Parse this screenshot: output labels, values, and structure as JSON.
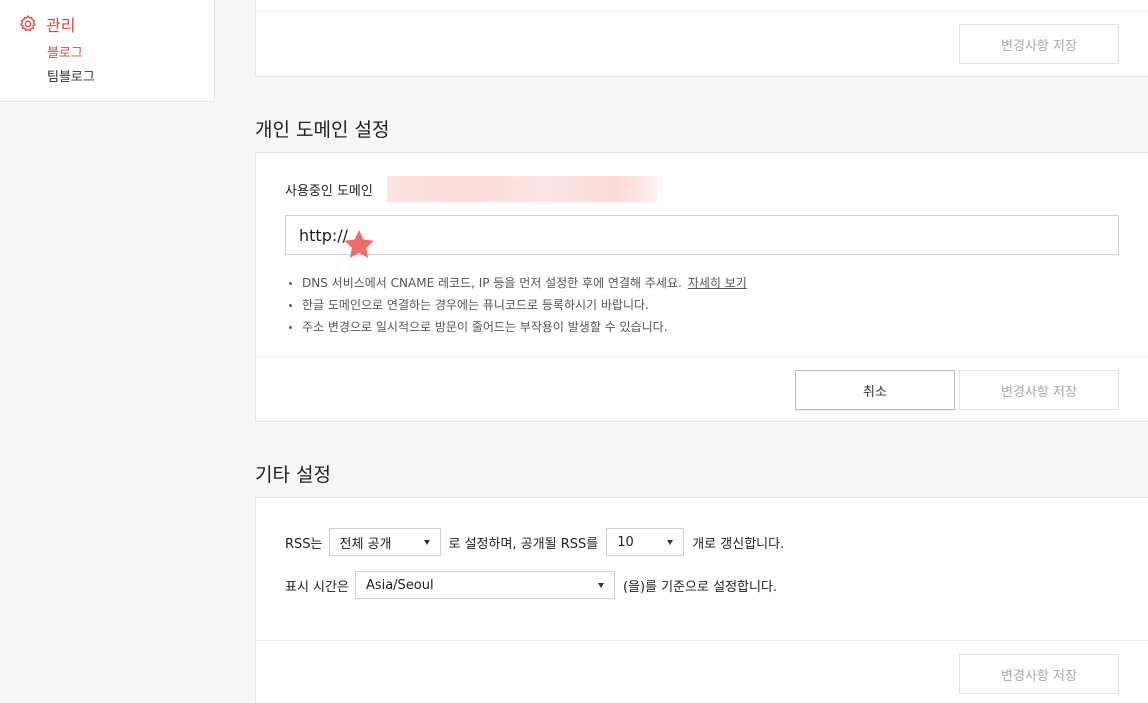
{
  "sidebar": {
    "heading": "관리",
    "items": [
      {
        "label": "블로그",
        "active": true
      },
      {
        "label": "팀블로그",
        "active": false
      }
    ]
  },
  "top_card": {
    "save_label": "변경사항 저장"
  },
  "domain_section": {
    "title": "개인 도메인 설정",
    "current_domain_label": "사용중인 도메인",
    "url_value": "http://",
    "notes": [
      "DNS 서비스에서 CNAME 레코드, IP 등을 먼저 설정한 후에 연결해 주세요.",
      "한글 도메인으로 연결하는 경우에는 퓨니코드로 등록하시기 바랍니다.",
      "주소 변경으로 일시적으로 방문이 줄어드는 부작용이 발생할 수 있습니다."
    ],
    "more_link": "자세히 보기",
    "cancel_label": "취소",
    "save_label": "변경사항 저장"
  },
  "other_section": {
    "title": "기타 설정",
    "rss_prefix": "RSS는",
    "rss_visibility": "전체 공개",
    "rss_middle": "로 설정하며, 공개될 RSS를",
    "rss_count": "10",
    "rss_suffix": "개로 갱신합니다.",
    "tz_prefix": "표시 시간은",
    "tz_value": "Asia/Seoul",
    "tz_suffix": "(을)를 기준으로 설정합니다.",
    "save_label": "변경사항 저장"
  },
  "colors": {
    "accent": "#e2483d",
    "star": "#f06a6a"
  },
  "icons": [
    "gear-icon",
    "star-icon",
    "caret-down-icon"
  ]
}
